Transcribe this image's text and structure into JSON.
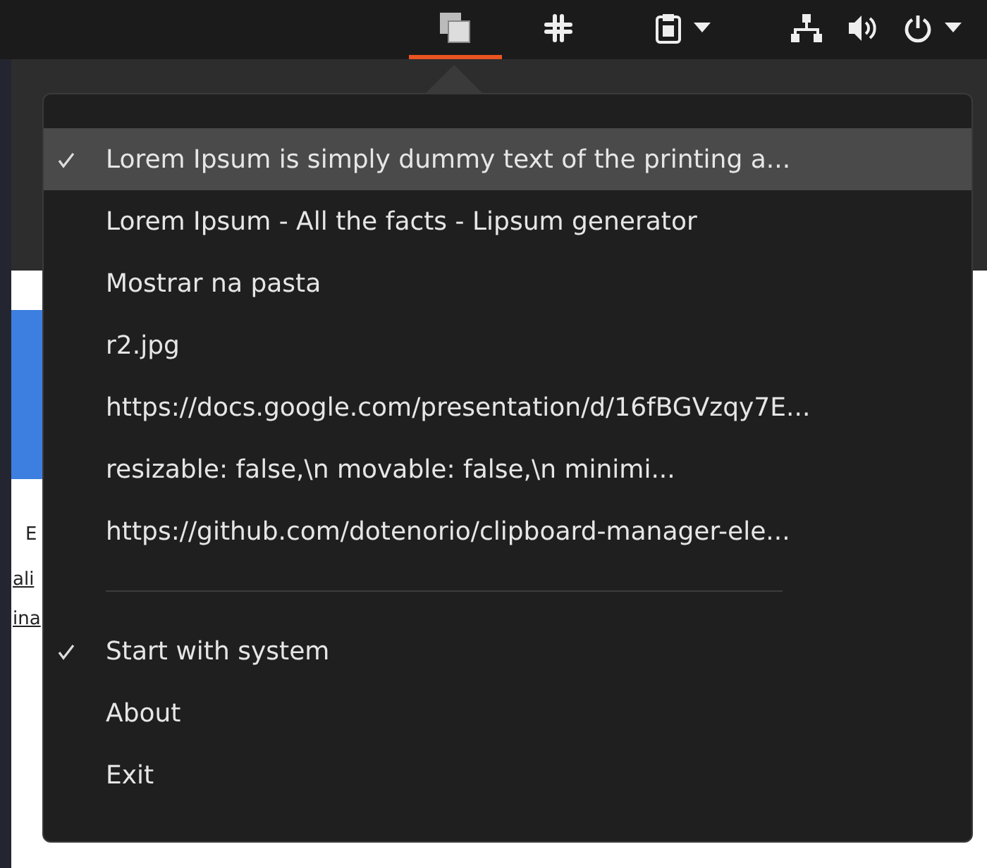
{
  "top_bar": {
    "tray": [
      {
        "kind": "windows",
        "selected": true
      },
      {
        "kind": "hash",
        "selected": false
      },
      {
        "kind": "clipboard",
        "selected": false
      },
      {
        "kind": "network",
        "selected": false
      },
      {
        "kind": "volume",
        "selected": false
      },
      {
        "kind": "power",
        "selected": false
      }
    ]
  },
  "background_window": {
    "fragments": [
      "E",
      "ali",
      "ina"
    ]
  },
  "menu": {
    "items": [
      {
        "kind": "item",
        "text": "Lorem Ipsum is simply dummy text of the printing a...",
        "checked": true,
        "selected": true
      },
      {
        "kind": "item",
        "text": "Lorem Ipsum - All the facts - Lipsum generator",
        "checked": false,
        "selected": false
      },
      {
        "kind": "item",
        "text": "Mostrar na pasta",
        "checked": false,
        "selected": false
      },
      {
        "kind": "item",
        "text": "r2.jpg",
        "checked": false,
        "selected": false
      },
      {
        "kind": "item",
        "text": "https://docs.google.com/presentation/d/16fBGVzqy7E...",
        "checked": false,
        "selected": false
      },
      {
        "kind": "item",
        "text": "resizable: false,\\n   movable: false,\\n   minimi...",
        "checked": false,
        "selected": false
      },
      {
        "kind": "item",
        "text": "https://github.com/dotenorio/clipboard-manager-ele...",
        "checked": false,
        "selected": false
      },
      {
        "kind": "separator"
      },
      {
        "kind": "item",
        "text": "Start with system",
        "checked": true,
        "selected": false
      },
      {
        "kind": "item",
        "text": "About",
        "checked": false,
        "selected": false
      },
      {
        "kind": "item",
        "text": "Exit",
        "checked": false,
        "selected": false
      }
    ]
  }
}
